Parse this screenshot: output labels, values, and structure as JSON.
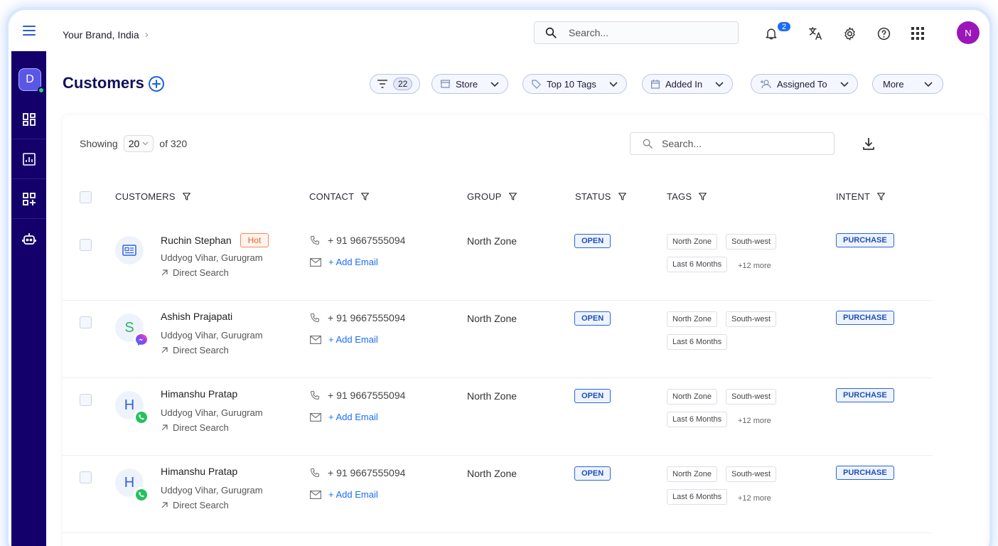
{
  "topbar": {
    "brand": "Your Brand, India",
    "search_placeholder": "Search...",
    "notification_count": "2",
    "user_initial": "N"
  },
  "sidebar": {
    "workspace_initial": "D",
    "items": [
      "dashboard-icon",
      "reports-icon",
      "apps-add-icon",
      "bot-icon"
    ]
  },
  "page": {
    "title": "Customers",
    "filters": {
      "filter_count": "22",
      "store": "Store",
      "top_tags": "Top 10 Tags",
      "added_in": "Added In",
      "assigned_to": "Assigned To",
      "more": "More"
    }
  },
  "table": {
    "showing_label": "Showing",
    "page_size": "20",
    "of_total": "of 320",
    "search_placeholder": "Search...",
    "columns": {
      "customers": "CUSTOMERS",
      "contact": "CONTACT",
      "group": "GROUP",
      "status": "STATUS",
      "tags": "TAGS",
      "intent": "INTENT"
    },
    "rows": [
      {
        "name": "Ruchin Stephan",
        "badge": "Hot",
        "location": "Uddyog Vihar, Gurugram",
        "source": "Direct Search",
        "phone": "+ 91 9667555094",
        "email": "+ Add Email",
        "group": "North Zone",
        "status": "OPEN",
        "tags": [
          "North Zone",
          "South-west",
          "Last 6 Months"
        ],
        "more_tags": "+12 more",
        "intent": "PURCHASE",
        "avatar": "",
        "channel": ""
      },
      {
        "name": "Ashish Prajapati",
        "badge": "",
        "location": "Uddyog Vihar, Gurugram",
        "source": "Direct Search",
        "phone": "+ 91 9667555094",
        "email": "+ Add Email",
        "group": "North Zone",
        "status": "OPEN",
        "tags": [
          "North Zone",
          "South-west",
          "Last 6 Months"
        ],
        "more_tags": "",
        "intent": "PURCHASE",
        "avatar": "S",
        "channel": "messenger"
      },
      {
        "name": "Himanshu Pratap",
        "badge": "",
        "location": "Uddyog Vihar, Gurugram",
        "source": "Direct Search",
        "phone": "+ 91 9667555094",
        "email": "+ Add Email",
        "group": "North Zone",
        "status": "OPEN",
        "tags": [
          "North Zone",
          "South-west",
          "Last 6 Months"
        ],
        "more_tags": "+12 more",
        "intent": "PURCHASE",
        "avatar": "H",
        "channel": "whatsapp"
      },
      {
        "name": "Himanshu Pratap",
        "badge": "",
        "location": "Uddyog Vihar, Gurugram",
        "source": "Direct Search",
        "phone": "+ 91 9667555094",
        "email": "+ Add Email",
        "group": "North Zone",
        "status": "OPEN",
        "tags": [
          "North Zone",
          "South-west",
          "Last 6 Months"
        ],
        "more_tags": "+12 more",
        "intent": "PURCHASE",
        "avatar": "H",
        "channel": "whatsapp"
      }
    ]
  },
  "colors": {
    "accent": "#1a6ef5",
    "sidebar": "#13006b",
    "title": "#10105a",
    "hot": "#e8632b",
    "avatar_user": "#9b16b8"
  }
}
